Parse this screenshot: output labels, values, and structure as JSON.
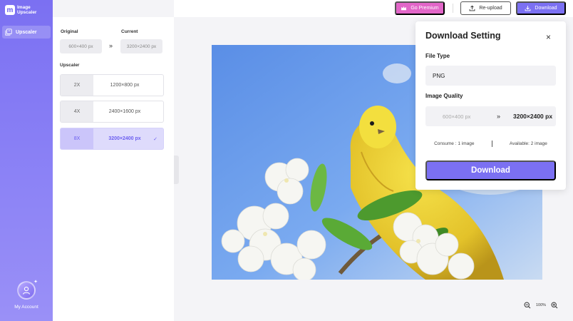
{
  "app": {
    "name_line1": "Image",
    "name_line2": "Upscaler",
    "logo_glyph": "m"
  },
  "sidebar": {
    "nav": [
      {
        "label": "Upscaler",
        "icon": "image-stack-icon"
      }
    ],
    "account_label": "My Account"
  },
  "settings": {
    "original_label": "Original",
    "current_label": "Current",
    "original_size": "600×400 px",
    "current_size": "3200×2400 px",
    "arrows": "»",
    "upscaler_label": "Upscaler",
    "options": [
      {
        "scale": "2X",
        "size": "1200×800 px",
        "selected": false
      },
      {
        "scale": "4X",
        "size": "2400×1600 px",
        "selected": false
      },
      {
        "scale": "8X",
        "size": "3200×2400 px",
        "selected": true
      }
    ],
    "check": "✓"
  },
  "toolbar": {
    "premium_label": "Go Premium",
    "reupload_label": "Re-upload",
    "download_label": "Download"
  },
  "zoom": {
    "value": "100%"
  },
  "download_setting": {
    "title": "Download Setting",
    "close": "×",
    "file_type_label": "File Type",
    "file_type_value": "PNG",
    "quality_label": "Image Quality",
    "quality_from": "600×400 px",
    "quality_arrows": "»",
    "quality_to": "3200×2400 px",
    "consume": "Consume : 1 image",
    "available": "Available: 2 image",
    "download_button": "Download"
  },
  "colors": {
    "accent": "#7b70f2",
    "premium": "#e266c8",
    "selected_bg": "#dedbfc"
  }
}
